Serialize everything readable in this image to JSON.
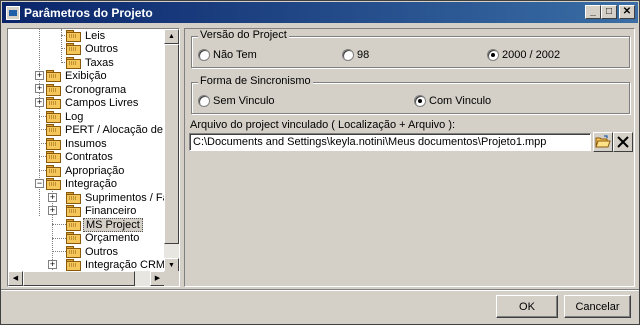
{
  "window": {
    "title": "Parâmetros do Projeto",
    "controls": {
      "minimize": "_",
      "maximize": "□",
      "close": "✕"
    }
  },
  "tree": {
    "items": [
      {
        "label": "Leis"
      },
      {
        "label": "Outros"
      },
      {
        "label": "Taxas"
      },
      {
        "label": "Exibição"
      },
      {
        "label": "Cronograma"
      },
      {
        "label": "Campos Livres"
      },
      {
        "label": "Log"
      },
      {
        "label": "PERT / Alocação de Recur"
      },
      {
        "label": "Insumos"
      },
      {
        "label": "Contratos"
      },
      {
        "label": "Apropriação"
      },
      {
        "label": "Integração"
      },
      {
        "label": "Suprimentos / Faturar"
      },
      {
        "label": "Financeiro"
      },
      {
        "label": "MS Project"
      },
      {
        "label": "Orçamento"
      },
      {
        "label": "Outros"
      },
      {
        "label": "Integração CRM"
      }
    ],
    "selected": "MS Project"
  },
  "versao": {
    "legend": "Versão do Project",
    "options": [
      {
        "label": "Não Tem",
        "checked": false
      },
      {
        "label": "98",
        "checked": false
      },
      {
        "label": "2000 / 2002",
        "checked": true
      }
    ]
  },
  "sincronismo": {
    "legend": "Forma de Sincronismo",
    "options": [
      {
        "label": "Sem Vinculo",
        "checked": false
      },
      {
        "label": "Com Vinculo",
        "checked": true
      }
    ]
  },
  "arquivo": {
    "label": "Arquivo do project vinculado ( Localização + Arquivo ):",
    "value": "C:\\Documents and Settings\\keyla.notini\\Meus documentos\\Projeto1.mpp",
    "icons": {
      "open": "open-folder-icon",
      "clear": "close-icon"
    }
  },
  "footer": {
    "ok": "OK",
    "cancel": "Cancelar"
  },
  "colors": {
    "face": "#d4d0c8",
    "title_start": "#0a246a",
    "title_end": "#3a6ea5",
    "folder": "#f5c65a"
  }
}
